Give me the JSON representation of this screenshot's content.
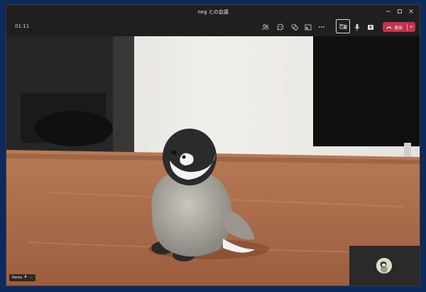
{
  "window": {
    "title": "neg との会議",
    "controls": [
      "minimize-icon",
      "maximize-icon",
      "close-icon"
    ]
  },
  "toolbar": {
    "timer": "01:11",
    "icons": [
      "people-icon",
      "chat-icon",
      "reactions-icon",
      "share-tray-icon",
      "more-icon",
      "camera-off-icon",
      "microphone-icon",
      "share-screen-icon"
    ],
    "leave_label": "退出",
    "leave_color": "#c4314b"
  },
  "participant": {
    "name": "Penta",
    "more": "···",
    "mic_icon": "microphone-icon"
  },
  "self_view": {
    "avatar": "avatar-icon"
  }
}
